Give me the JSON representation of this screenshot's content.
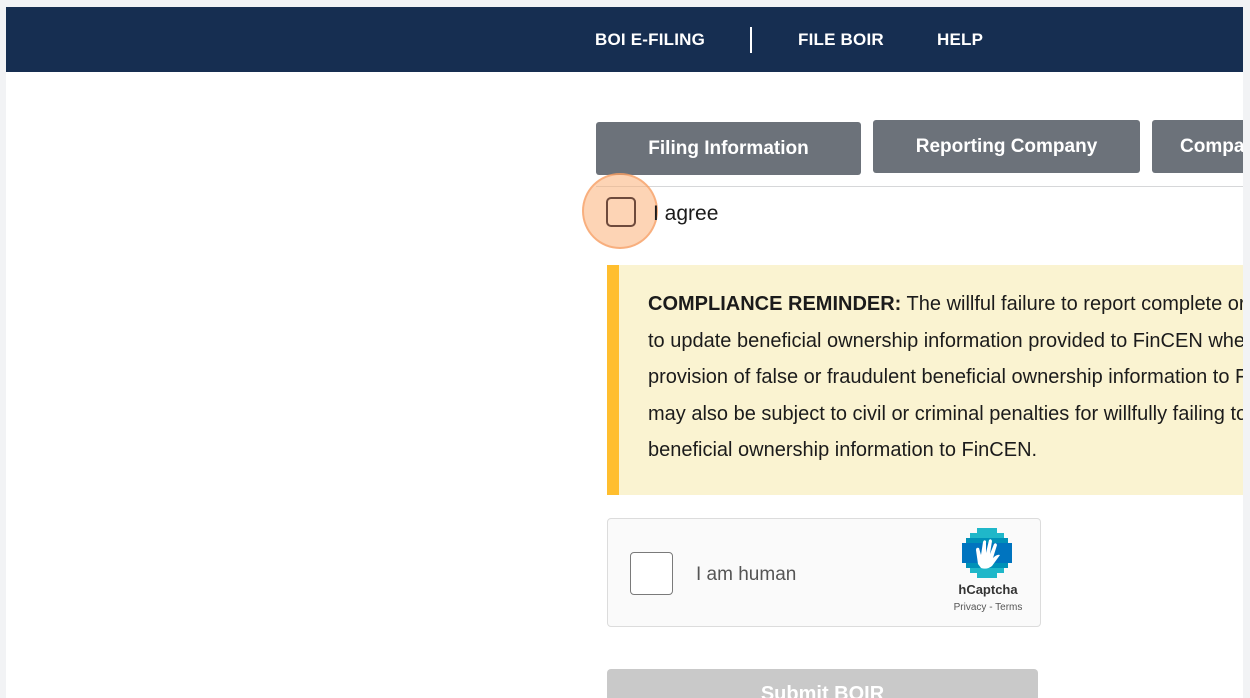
{
  "nav": {
    "items": [
      "BOI E-FILING",
      "FILE BOIR",
      "HELP"
    ]
  },
  "tabs": [
    {
      "label": "Filing Information"
    },
    {
      "label": "Reporting Company"
    },
    {
      "label": "Company Applicants"
    }
  ],
  "agree": {
    "label": "I agree"
  },
  "reminder": {
    "heading": "COMPLIANCE REMINDER:",
    "lines": [
      "The willful failure to report complete or updated beneficial ownership information to FinCEN, or the willful failure",
      "to update beneficial ownership information provided to FinCEN when required, or the willful",
      "provision of false or fraudulent beneficial ownership information to FinCEN, may result in",
      "may also be subject to civil or criminal penalties for willfully failing to report complete or updated",
      "beneficial ownership information to FinCEN."
    ]
  },
  "captcha": {
    "label": "I am human",
    "brand": "hCaptcha",
    "links": "Privacy - Terms"
  },
  "submit": {
    "label": "Submit BOIR"
  },
  "colors": {
    "nav_background": "#162e51",
    "tab_background": "#6c727a",
    "reminder_background": "#faf3d1",
    "reminder_accent": "#ffbe2e",
    "highlight": "#fbb079",
    "submit_disabled": "#c9c9c9"
  }
}
